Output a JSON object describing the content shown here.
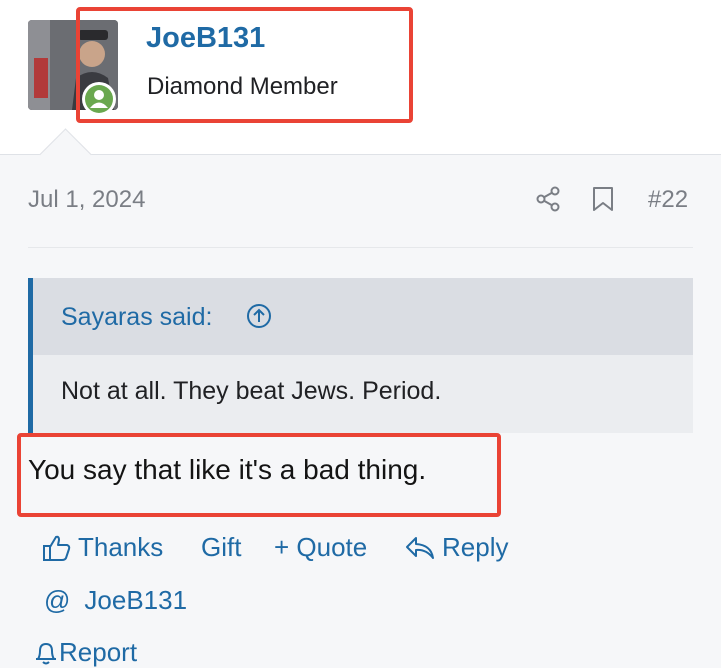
{
  "post": {
    "author": {
      "username": "JoeB131",
      "title": "Diamond Member",
      "online": true
    },
    "date": "Jul 1, 2024",
    "number": "#22",
    "quote": {
      "author_label": "Sayaras said:",
      "text": "Not at all. They beat Jews. Period."
    },
    "body": "You say that like it's a bad thing."
  },
  "actions": {
    "thanks": "Thanks",
    "gift": "Gift",
    "quote": "+ Quote",
    "reply": "Reply",
    "mention_symbol": "@",
    "mention_user": "JoeB131",
    "report": "Report"
  },
  "colors": {
    "accent": "#1f6aa5",
    "highlight_box": "#ea4335",
    "online": "#6aa84f",
    "muted": "#7a7e85"
  },
  "icons": [
    "share-icon",
    "bookmark-icon",
    "quote-arrow-icon",
    "thumbs-up-icon",
    "reply-arrow-icon",
    "bell-icon"
  ]
}
